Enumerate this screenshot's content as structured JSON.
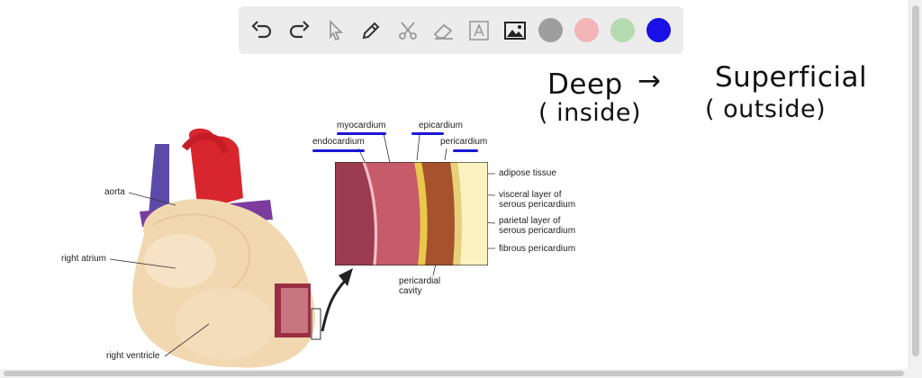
{
  "toolbar": {
    "tools": [
      {
        "name": "undo",
        "icon": "undo-icon"
      },
      {
        "name": "redo",
        "icon": "redo-icon"
      },
      {
        "name": "select",
        "icon": "pointer-icon"
      },
      {
        "name": "pen",
        "icon": "pen-icon"
      },
      {
        "name": "tools",
        "icon": "scissors-icon"
      },
      {
        "name": "eraser",
        "icon": "eraser-icon"
      },
      {
        "name": "text",
        "icon": "text-icon"
      },
      {
        "name": "image",
        "icon": "image-icon"
      }
    ],
    "colors": [
      "#9e9e9e",
      "#f3b5b8",
      "#b5dbb1",
      "#1a10e6"
    ]
  },
  "notes": {
    "deep": "Deep",
    "inside": "( inside)",
    "arrow": "→",
    "superficial": "Superficial",
    "outside": "( outside)"
  },
  "diagram": {
    "layers_top": {
      "myocardium": "myocardium",
      "epicardium": "epicardium",
      "endocardium": "endocardium",
      "pericardium": "pericardium"
    },
    "layers_right": {
      "adipose": "adipose tissue",
      "visceral_1": "visceral layer of",
      "visceral_2": "serous pericardium",
      "parietal_1": "parietal layer of",
      "parietal_2": "serous pericardium",
      "fibrous": "fibrous pericardium"
    },
    "cavity_1": "pericardial",
    "cavity_2": "cavity",
    "heart": {
      "aorta": "aorta",
      "right_atrium": "right atrium",
      "right_ventricle": "right ventricle"
    }
  }
}
